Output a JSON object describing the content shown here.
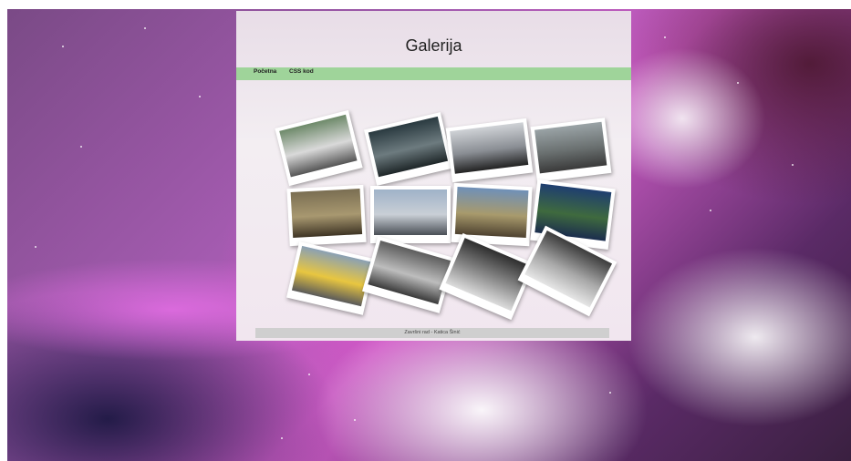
{
  "page": {
    "title": "Galerija",
    "nav": [
      "Početna",
      "CSS kod"
    ],
    "footer": "Završni rad - Katica Šinić"
  },
  "photos": [
    {
      "name": "photo-building",
      "colors": [
        "#6e8a6a",
        "#d9d9d9",
        "#555"
      ]
    },
    {
      "name": "photo-musician",
      "colors": [
        "#2a3a40",
        "#6d7b7f",
        "#1e2628"
      ]
    },
    {
      "name": "photo-car",
      "colors": [
        "#cfd2d6",
        "#8a8e94",
        "#222"
      ]
    },
    {
      "name": "photo-race",
      "colors": [
        "#9aa3a6",
        "#6a7070",
        "#3a3a3a"
      ]
    },
    {
      "name": "photo-fisherman",
      "colors": [
        "#7a6e52",
        "#a89870",
        "#3e3424"
      ]
    },
    {
      "name": "photo-train-station",
      "colors": [
        "#9fb2c8",
        "#c9cfd6",
        "#4a4f56"
      ]
    },
    {
      "name": "photo-square",
      "colors": [
        "#6f90b8",
        "#a89a6c",
        "#4e4230"
      ]
    },
    {
      "name": "photo-lake",
      "colors": [
        "#1e3e70",
        "#3f6a3e",
        "#1b2d4e"
      ]
    },
    {
      "name": "photo-train",
      "colors": [
        "#8aa0b4",
        "#e8c640",
        "#5a5a5a"
      ]
    },
    {
      "name": "photo-graffiti",
      "colors": [
        "#5c5c5c",
        "#bdbdbd",
        "#3a3a3a"
      ]
    },
    {
      "name": "photo-trees",
      "colors": [
        "#2e2e2e",
        "#8c8c8c",
        "#dcdcdc"
      ]
    },
    {
      "name": "photo-fountain",
      "colors": [
        "#3c3c3c",
        "#a8a8a8",
        "#e6e6e6"
      ]
    }
  ]
}
